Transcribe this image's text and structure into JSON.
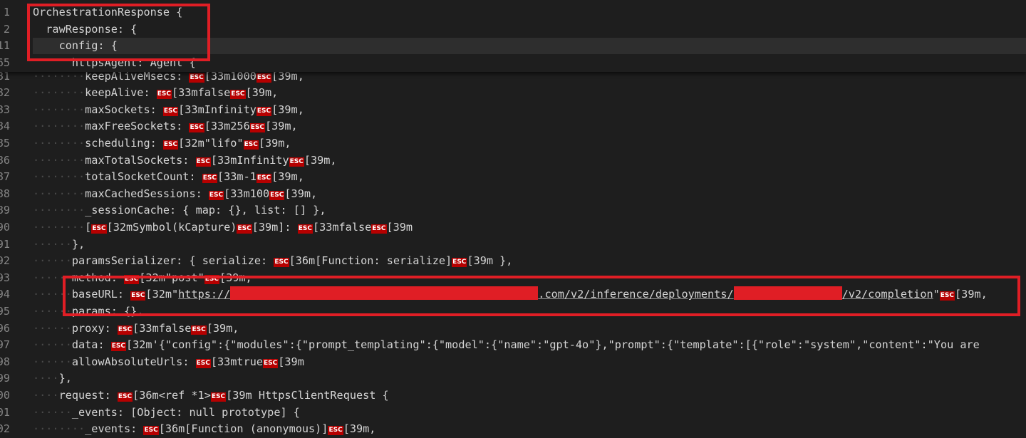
{
  "sticky_lines": [
    {
      "num": "1",
      "text": "OrchestrationResponse {"
    },
    {
      "num": "2",
      "text": "  rawResponse: {"
    },
    {
      "num": "11",
      "text": "    config: {"
    },
    {
      "num": "65",
      "text": "      httpsAgent: Agent {"
    }
  ],
  "lines": [
    {
      "num": "81",
      "indent": "········",
      "parts": [
        "keepAliveMsecs: ",
        "ESC",
        "[33m1000",
        "ESC",
        "[39m,"
      ]
    },
    {
      "num": "82",
      "indent": "········",
      "parts": [
        "keepAlive: ",
        "ESC",
        "[33mfalse",
        "ESC",
        "[39m,"
      ]
    },
    {
      "num": "83",
      "indent": "········",
      "parts": [
        "maxSockets: ",
        "ESC",
        "[33mInfinity",
        "ESC",
        "[39m,"
      ]
    },
    {
      "num": "84",
      "indent": "········",
      "parts": [
        "maxFreeSockets: ",
        "ESC",
        "[33m256",
        "ESC",
        "[39m,"
      ]
    },
    {
      "num": "85",
      "indent": "········",
      "parts": [
        "scheduling: ",
        "ESC",
        "[32m\"lifo\"",
        "ESC",
        "[39m,"
      ]
    },
    {
      "num": "86",
      "indent": "········",
      "parts": [
        "maxTotalSockets: ",
        "ESC",
        "[33mInfinity",
        "ESC",
        "[39m,"
      ]
    },
    {
      "num": "87",
      "indent": "········",
      "parts": [
        "totalSocketCount: ",
        "ESC",
        "[33m-1",
        "ESC",
        "[39m,"
      ]
    },
    {
      "num": "88",
      "indent": "········",
      "parts": [
        "maxCachedSessions: ",
        "ESC",
        "[33m100",
        "ESC",
        "[39m,"
      ]
    },
    {
      "num": "89",
      "indent": "········",
      "parts": [
        "_sessionCache: { map: {}, list: [] },"
      ]
    },
    {
      "num": "90",
      "indent": "········",
      "parts": [
        "[",
        "ESC",
        "[32mSymbol(kCapture)",
        "ESC",
        "[39m]: ",
        "ESC",
        "[33mfalse",
        "ESC",
        "[39m"
      ]
    },
    {
      "num": "91",
      "indent": "······",
      "parts": [
        "},"
      ]
    },
    {
      "num": "92",
      "indent": "······",
      "parts": [
        "paramsSerializer: { serialize: ",
        "ESC",
        "[36m[Function: serialize]",
        "ESC",
        "[39m },"
      ]
    },
    {
      "num": "93",
      "indent": "······",
      "parts": [
        "method: ",
        "ESC",
        "[32m\"post\"",
        "ESC",
        "[39m,"
      ]
    },
    {
      "num": "94",
      "indent": "······",
      "parts": [
        "baseURL: ",
        "ESC",
        "[32m\"",
        "URL"
      ]
    },
    {
      "num": "95",
      "indent": "······",
      "parts": [
        "params: {},"
      ]
    },
    {
      "num": "96",
      "indent": "······",
      "parts": [
        "proxy: ",
        "ESC",
        "[33mfalse",
        "ESC",
        "[39m,"
      ]
    },
    {
      "num": "97",
      "indent": "······",
      "parts": [
        "data: ",
        "ESC",
        "[32m'{\"config\":{\"modules\":{\"prompt_templating\":{\"model\":{\"name\":\"gpt-4o\"},\"prompt\":{\"template\":[{\"role\":\"system\",\"content\":\"You are"
      ]
    },
    {
      "num": "98",
      "indent": "······",
      "parts": [
        "allowAbsoluteUrls: ",
        "ESC",
        "[33mtrue",
        "ESC",
        "[39m"
      ]
    },
    {
      "num": "99",
      "indent": "····",
      "parts": [
        "},"
      ]
    },
    {
      "num": "100",
      "indent": "····",
      "parts": [
        "request: ",
        "ESC",
        "[36m<ref *1>",
        "ESC",
        "[39m HttpsClientRequest {"
      ]
    },
    {
      "num": "101",
      "indent": "······",
      "parts": [
        "_events: [Object: null prototype] {"
      ]
    },
    {
      "num": "102",
      "indent": "········",
      "parts": [
        "_events: ",
        "ESC",
        "[36m[Function (anonymous)]",
        "ESC",
        "[39m,"
      ]
    }
  ],
  "esc_label": "ESC",
  "url": {
    "prefix": "https://",
    "middle": ".com/v2/inference/deployments/",
    "suffix": "/v2/completion",
    "close": "\"",
    "after": "[39m,"
  },
  "colors": {
    "background": "#1e1e1e",
    "text": "#d4d4d4",
    "line_number": "#858585",
    "esc_badge": "#b60000",
    "highlight_box": "#e01e25"
  }
}
